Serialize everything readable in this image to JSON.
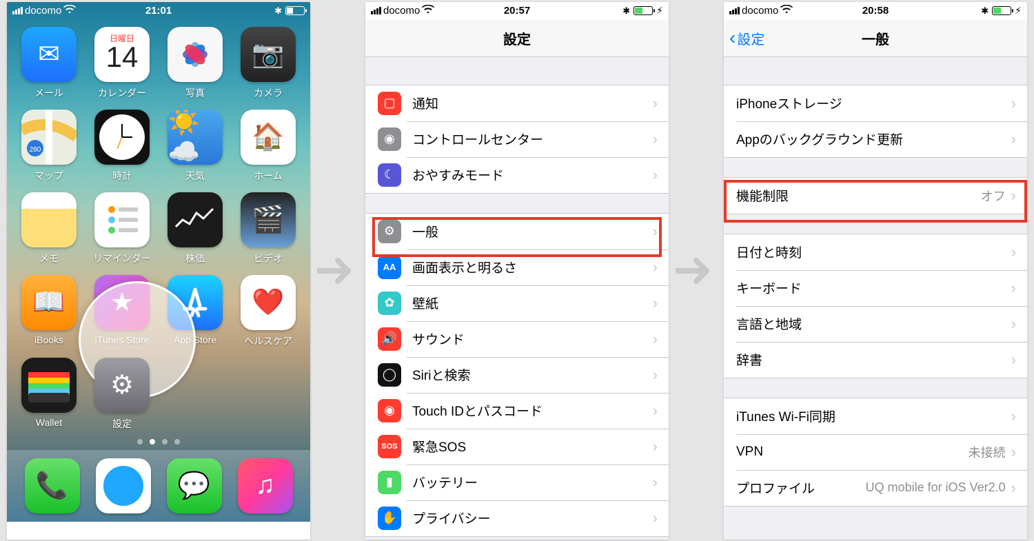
{
  "screen1": {
    "status": {
      "carrier": "docomo",
      "time": "21:01"
    },
    "calendar": {
      "day": "日曜日",
      "date": "14"
    },
    "apps": {
      "mail": "メール",
      "calendar": "カレンダー",
      "photos": "写真",
      "camera": "カメラ",
      "maps": "マップ",
      "clock": "時計",
      "weather": "天気",
      "home": "ホーム",
      "notes": "メモ",
      "reminders": "リマインダー",
      "stocks": "株価",
      "videos": "ビデオ",
      "ibooks": "iBooks",
      "itunes": "iTunes Store",
      "appstore": "App Store",
      "health": "ヘルスケア",
      "wallet": "Wallet",
      "settings": "設定"
    }
  },
  "screen2": {
    "status": {
      "carrier": "docomo",
      "time": "20:57"
    },
    "title": "設定",
    "rows": {
      "notifications": "通知",
      "controlcenter": "コントロールセンター",
      "dnd": "おやすみモード",
      "general": "一般",
      "display": "画面表示と明るさ",
      "wallpaper": "壁紙",
      "sound": "サウンド",
      "siri": "Siriと検索",
      "touchid": "Touch IDとパスコード",
      "sos": "緊急SOS",
      "battery": "バッテリー",
      "privacy": "プライバシー"
    }
  },
  "screen3": {
    "status": {
      "carrier": "docomo",
      "time": "20:58"
    },
    "back": "設定",
    "title": "一般",
    "rows": {
      "storage": "iPhoneストレージ",
      "bg": "Appのバックグラウンド更新",
      "restrict": "機能制限",
      "restrict_val": "オフ",
      "datetime": "日付と時刻",
      "keyboard": "キーボード",
      "lang": "言語と地域",
      "dict": "辞書",
      "itunes": "iTunes Wi-Fi同期",
      "vpn": "VPN",
      "vpn_val": "未接続",
      "profile": "プロファイル",
      "profile_val": "UQ mobile for iOS Ver2.0"
    }
  }
}
